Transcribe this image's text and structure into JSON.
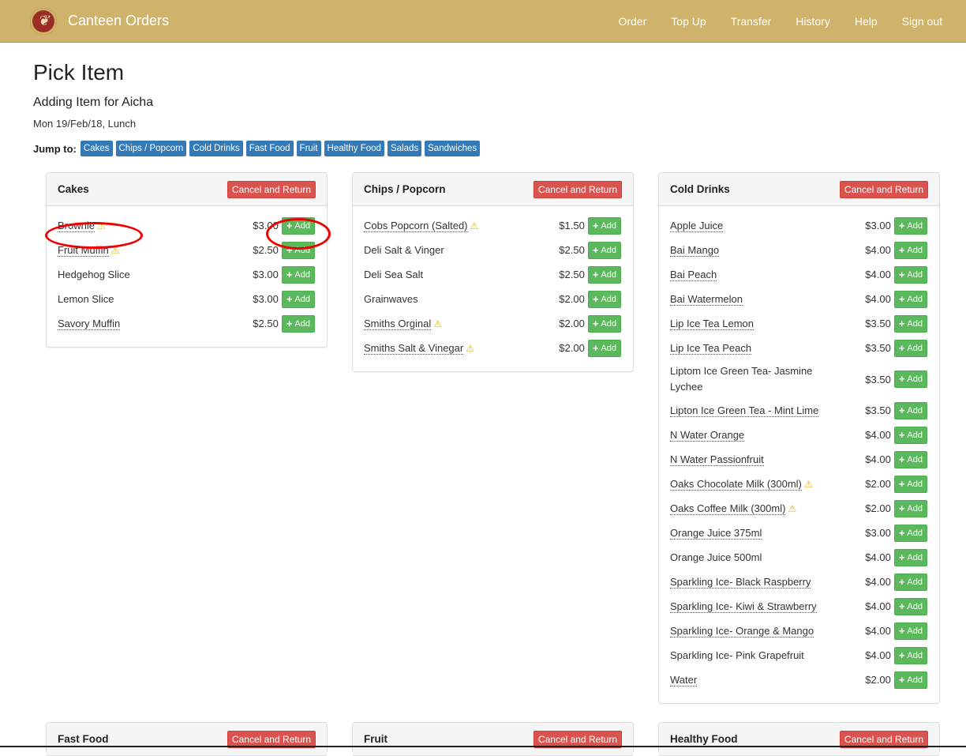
{
  "navbar": {
    "logo_icon": "crest-logo-icon",
    "brand": "Canteen Orders",
    "links": [
      "Order",
      "Top Up",
      "Transfer",
      "History",
      "Help",
      "Sign out"
    ]
  },
  "page": {
    "title": "Pick Item",
    "subtitle": "Adding Item for Aicha",
    "date": "Mon 19/Feb/18, Lunch"
  },
  "jump": {
    "label": "Jump to:",
    "tags": [
      "Cakes",
      "Chips / Popcorn",
      "Cold Drinks",
      "Fast Food",
      "Fruit",
      "Healthy Food",
      "Salads",
      "Sandwiches"
    ]
  },
  "cancel_label": "Cancel and Return",
  "add_label": "Add",
  "colors": {
    "navbar": "#cfb36a",
    "tag": "#337ab7",
    "cancel": "#d9534f",
    "add": "#5cb85c",
    "highlight": "#e00000"
  },
  "panels": [
    {
      "title": "Cakes",
      "items": [
        {
          "name": "Brownie",
          "price": "$3.00",
          "link": true,
          "warn": true
        },
        {
          "name": "Fruit Muffin",
          "price": "$2.50",
          "link": true,
          "warn": true
        },
        {
          "name": "Hedgehog Slice",
          "price": "$3.00",
          "link": false,
          "warn": false
        },
        {
          "name": "Lemon Slice",
          "price": "$3.00",
          "link": false,
          "warn": false
        },
        {
          "name": "Savory Muffin",
          "price": "$2.50",
          "link": true,
          "warn": false
        }
      ]
    },
    {
      "title": "Chips / Popcorn",
      "items": [
        {
          "name": "Cobs Popcorn (Salted)",
          "price": "$1.50",
          "link": true,
          "warn": true
        },
        {
          "name": "Deli Salt & Vinger",
          "price": "$2.50",
          "link": false,
          "warn": false
        },
        {
          "name": "Deli Sea Salt",
          "price": "$2.50",
          "link": false,
          "warn": false
        },
        {
          "name": "Grainwaves",
          "price": "$2.00",
          "link": false,
          "warn": false
        },
        {
          "name": "Smiths Orginal",
          "price": "$2.00",
          "link": true,
          "warn": true
        },
        {
          "name": "Smiths Salt & Vinegar",
          "price": "$2.00",
          "link": true,
          "warn": true
        }
      ]
    },
    {
      "title": "Cold Drinks",
      "items": [
        {
          "name": "Apple Juice",
          "price": "$3.00",
          "link": true,
          "warn": false
        },
        {
          "name": "Bai Mango",
          "price": "$4.00",
          "link": true,
          "warn": false
        },
        {
          "name": "Bai Peach",
          "price": "$4.00",
          "link": true,
          "warn": false
        },
        {
          "name": "Bai Watermelon",
          "price": "$4.00",
          "link": true,
          "warn": false
        },
        {
          "name": "Lip Ice Tea Lemon",
          "price": "$3.50",
          "link": true,
          "warn": false
        },
        {
          "name": "Lip Ice Tea Peach",
          "price": "$3.50",
          "link": true,
          "warn": false
        },
        {
          "name": "Liptom Ice Green Tea- Jasmine Lychee",
          "price": "$3.50",
          "link": false,
          "warn": false
        },
        {
          "name": "Lipton Ice Green Tea - Mint Lime",
          "price": "$3.50",
          "link": true,
          "warn": false
        },
        {
          "name": "N Water Orange",
          "price": "$4.00",
          "link": true,
          "warn": false
        },
        {
          "name": "N Water Passionfruit",
          "price": "$4.00",
          "link": true,
          "warn": false
        },
        {
          "name": "Oaks Chocolate Milk (300ml)",
          "price": "$2.00",
          "link": true,
          "warn": true
        },
        {
          "name": "Oaks Coffee Milk (300ml)",
          "price": "$2.00",
          "link": true,
          "warn": true
        },
        {
          "name": "Orange Juice 375ml",
          "price": "$3.00",
          "link": true,
          "warn": false
        },
        {
          "name": "Orange Juice 500ml",
          "price": "$4.00",
          "link": false,
          "warn": false
        },
        {
          "name": "Sparkling Ice- Black Raspberry",
          "price": "$4.00",
          "link": true,
          "warn": false
        },
        {
          "name": "Sparkling Ice- Kiwi & Strawberry",
          "price": "$4.00",
          "link": true,
          "warn": false
        },
        {
          "name": "Sparkling Ice- Orange & Mango",
          "price": "$4.00",
          "link": true,
          "warn": false
        },
        {
          "name": "Sparkling Ice- Pink Grapefruit",
          "price": "$4.00",
          "link": false,
          "warn": false
        },
        {
          "name": "Water",
          "price": "$2.00",
          "link": true,
          "warn": false
        }
      ]
    },
    {
      "title": "Fast Food",
      "items": []
    },
    {
      "title": "Fruit",
      "items": []
    },
    {
      "title": "Healthy Food",
      "items": []
    }
  ]
}
